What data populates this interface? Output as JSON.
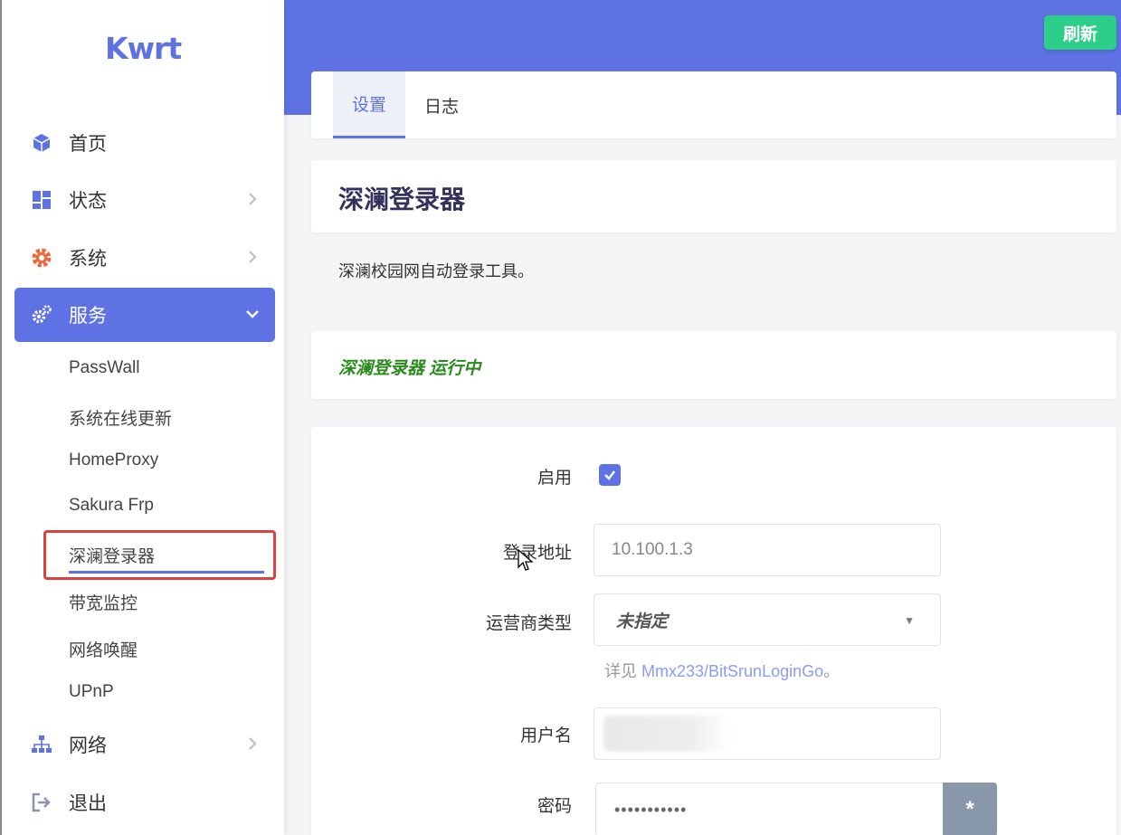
{
  "app": {
    "logo": "Kwrt"
  },
  "header": {
    "refresh_label": "刷新"
  },
  "sidebar": {
    "items": [
      {
        "label": "首页",
        "icon": "cube-icon"
      },
      {
        "label": "状态",
        "icon": "dashboard-icon"
      },
      {
        "label": "系统",
        "icon": "gear-icon"
      },
      {
        "label": "服务",
        "icon": "cogs-icon"
      },
      {
        "label": "网络",
        "icon": "sitemap-icon"
      },
      {
        "label": "退出",
        "icon": "logout-icon"
      }
    ],
    "services_sub": [
      {
        "label": "PassWall"
      },
      {
        "label": "系统在线更新"
      },
      {
        "label": "HomeProxy"
      },
      {
        "label": "Sakura Frp"
      },
      {
        "label": "深澜登录器"
      },
      {
        "label": "带宽监控"
      },
      {
        "label": "网络唤醒"
      },
      {
        "label": "UPnP"
      }
    ]
  },
  "tabs": [
    {
      "label": "设置"
    },
    {
      "label": "日志"
    }
  ],
  "page": {
    "title": "深澜登录器",
    "description": "深澜校园网自动登录工具。",
    "status": "深澜登录器 运行中"
  },
  "form": {
    "enable_label": "启用",
    "enabled": true,
    "login_url_label": "登录地址",
    "login_url_value": "10.100.1.3",
    "isp_label": "运营商类型",
    "isp_value": "未指定",
    "hint_prefix": "详见 ",
    "hint_link": "Mmx233/BitSrunLoginGo",
    "hint_suffix": "。",
    "username_label": "用户名",
    "password_label": "密码",
    "password_value": "•••••••••••",
    "password_toggle": "*"
  },
  "colors": {
    "accent": "#5e72e4",
    "success": "#2dce89",
    "status_text": "#2b8a1d",
    "highlight_box": "#d9423d"
  }
}
